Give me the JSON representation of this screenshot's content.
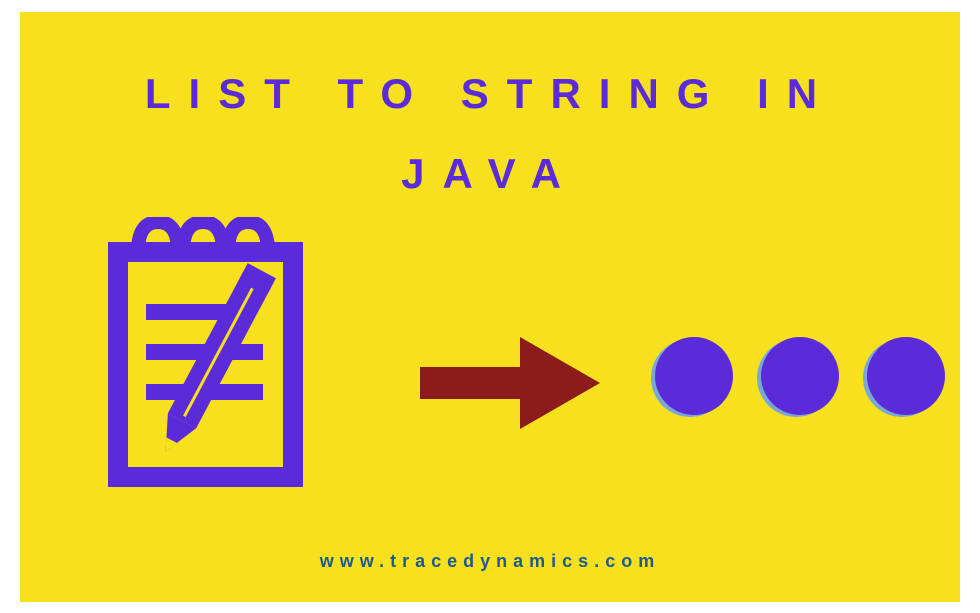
{
  "title": {
    "line1": "LIST TO STRING IN",
    "line2": "JAVA"
  },
  "url": "www.tracedynamics.com",
  "colors": {
    "background": "#f7e01e",
    "title": "#5b2bd9",
    "arrow": "#8c1c1c",
    "url": "#1f5a8c",
    "dot": "#5b2bd9"
  }
}
